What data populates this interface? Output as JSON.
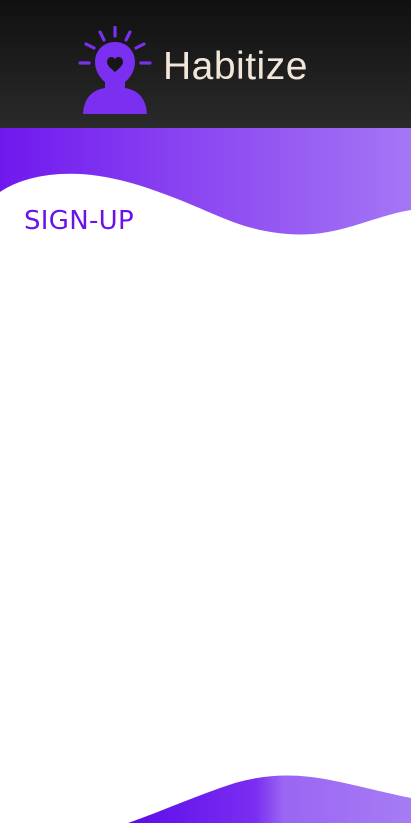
{
  "app": {
    "title": "Habitize",
    "logo_icon": "head-with-heart-icon"
  },
  "page": {
    "heading": "SIGN-UP"
  },
  "colors": {
    "header_background": "#161616",
    "brand_purple": "#6a12e8",
    "wave_light_purple": "#a77af4",
    "title_text": "#f1e6d9",
    "background": "#ffffff"
  }
}
